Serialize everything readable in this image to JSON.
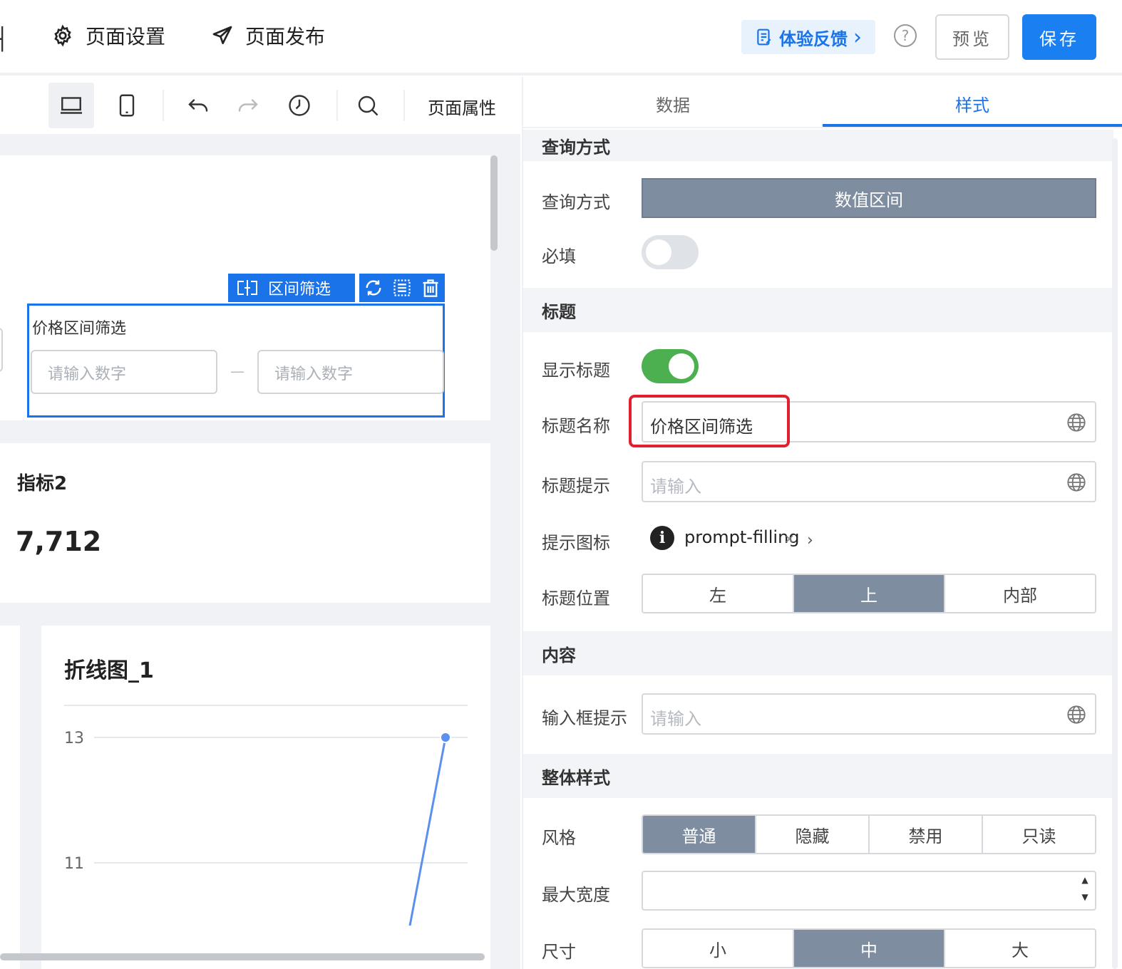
{
  "topbar": {
    "page_settings": "页面设置",
    "page_publish": "页面发布",
    "feedback": "体验反馈",
    "feedback_chevron": "›",
    "help": "?",
    "preview": "预览",
    "save": "保存"
  },
  "canvas_toolbar": {
    "page_properties": "页面属性"
  },
  "canvas": {
    "component_tag": "区间筛选",
    "filter_title": "价格区间筛选",
    "min_placeholder": "请输入数字",
    "max_placeholder": "请输入数字",
    "range_dash": "—",
    "kpi_title": "指标2",
    "kpi_value": "7,712",
    "chart_title": "折线图_1"
  },
  "chart_data": {
    "type": "line",
    "title": "折线图_1",
    "yticks": [
      13,
      11
    ],
    "series": [
      {
        "values": [
          13,
          10
        ]
      }
    ]
  },
  "panel": {
    "tabs": [
      {
        "label": "数据",
        "active": false
      },
      {
        "label": "样式",
        "active": true
      }
    ],
    "sections": {
      "query": "查询方式",
      "title": "标题",
      "content": "内容",
      "overall": "整体样式"
    },
    "query_mode_label": "查询方式",
    "query_mode_value": "数值区间",
    "required_label": "必填",
    "required_on": false,
    "show_title_label": "显示标题",
    "show_title_on": true,
    "title_name_label": "标题名称",
    "title_name_value": "价格区间筛选",
    "title_tip_label": "标题提示",
    "title_tip_placeholder": "请输入",
    "tip_icon_label": "提示图标",
    "tip_icon_value": "prompt-filling",
    "tip_icon_remove": "×",
    "tip_icon_chevron": "›",
    "title_position_label": "标题位置",
    "title_position_options": [
      "左",
      "上",
      "内部"
    ],
    "title_position_selected": "上",
    "input_tip_label": "输入框提示",
    "input_tip_placeholder": "请输入",
    "style_label": "风格",
    "style_options": [
      "普通",
      "隐藏",
      "禁用",
      "只读"
    ],
    "style_selected": "普通",
    "max_width_label": "最大宽度",
    "max_width_value": "",
    "size_label": "尺寸",
    "size_options": [
      "小",
      "中",
      "大"
    ],
    "size_selected": "中"
  },
  "colors": {
    "primary": "#1a73e8",
    "selected_segment": "#7e8da0",
    "toggle_on": "#4cb050",
    "highlight": "#e0202e"
  }
}
